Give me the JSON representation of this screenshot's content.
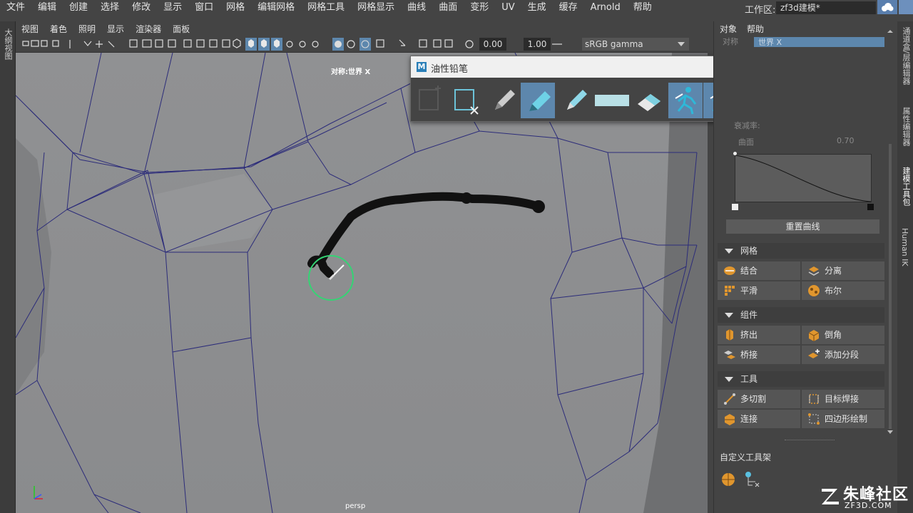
{
  "menubar": {
    "items": [
      "文件",
      "编辑",
      "创建",
      "选择",
      "修改",
      "显示",
      "窗口",
      "网格",
      "编辑网格",
      "网格工具",
      "网格显示",
      "曲线",
      "曲面",
      "变形",
      "UV",
      "生成",
      "缓存",
      "Arnold",
      "帮助"
    ],
    "workspace_label": "工作区:",
    "workspace_value": "zf3d建模*"
  },
  "left_strip": {
    "label": "大纲视图"
  },
  "panel_menu": {
    "items": [
      "视图",
      "着色",
      "照明",
      "显示",
      "渲染器",
      "面板"
    ]
  },
  "toolbar": {
    "field1": "0.00",
    "field2": "1.00",
    "colorspace": "sRGB gamma"
  },
  "viewport": {
    "symmetry_label": "对称:世界 X",
    "camera_label": "persp"
  },
  "grease_pencil": {
    "title": "油性铅笔",
    "help_glyph": "?",
    "buttons": [
      {
        "name": "add-frame",
        "active": false
      },
      {
        "name": "clear-frame",
        "active": false
      },
      {
        "name": "pencil",
        "active": false
      },
      {
        "name": "marker",
        "active": true
      },
      {
        "name": "soft-pencil",
        "active": false
      },
      {
        "name": "brush-size",
        "active": false
      },
      {
        "name": "eraser",
        "active": false
      },
      {
        "name": "ghost-previous",
        "active": true
      },
      {
        "name": "ghost-next",
        "active": true
      },
      {
        "name": "import",
        "active": false
      },
      {
        "name": "export",
        "active": false
      },
      {
        "name": "help",
        "active": false
      }
    ]
  },
  "right_panel": {
    "menu": [
      "对象",
      "帮助"
    ],
    "faded_row_label": "对称",
    "faded_row_value": "世界 X",
    "falloff_label": "衰减率:",
    "curve_mode": "曲面",
    "curve_value": "0.70",
    "reset_curve_label": "重置曲线",
    "sections": [
      {
        "title": "网格",
        "tools": [
          {
            "label": "结合",
            "icon": "combine-icon"
          },
          {
            "label": "分离",
            "icon": "separate-icon"
          },
          {
            "label": "平滑",
            "icon": "smooth-icon"
          },
          {
            "label": "布尔",
            "icon": "boolean-icon"
          }
        ]
      },
      {
        "title": "组件",
        "tools": [
          {
            "label": "挤出",
            "icon": "extrude-icon"
          },
          {
            "label": "倒角",
            "icon": "bevel-icon"
          },
          {
            "label": "桥接",
            "icon": "bridge-icon"
          },
          {
            "label": "添加分段",
            "icon": "add-divisions-icon"
          }
        ]
      },
      {
        "title": "工具",
        "tools": [
          {
            "label": "多切割",
            "icon": "multicut-icon"
          },
          {
            "label": "目标焊接",
            "icon": "target-weld-icon"
          },
          {
            "label": "连接",
            "icon": "connect-icon"
          },
          {
            "label": "四边形绘制",
            "icon": "quad-draw-icon"
          }
        ]
      }
    ],
    "custom_shelf_label": "自定义工具架"
  },
  "vertical_tabs": [
    "通道盒/层编辑器",
    "属性编辑器",
    "建模工具包",
    "Human IK"
  ],
  "watermark": {
    "zh": "朱峰社区",
    "en": "ZF3D.COM"
  },
  "colors": {
    "ui_bg": "#444444",
    "viewport_bg": "#8a8b8d",
    "wire": "#2c2c7a",
    "accent": "#5d87ad",
    "brush_ring": "#34d474"
  }
}
